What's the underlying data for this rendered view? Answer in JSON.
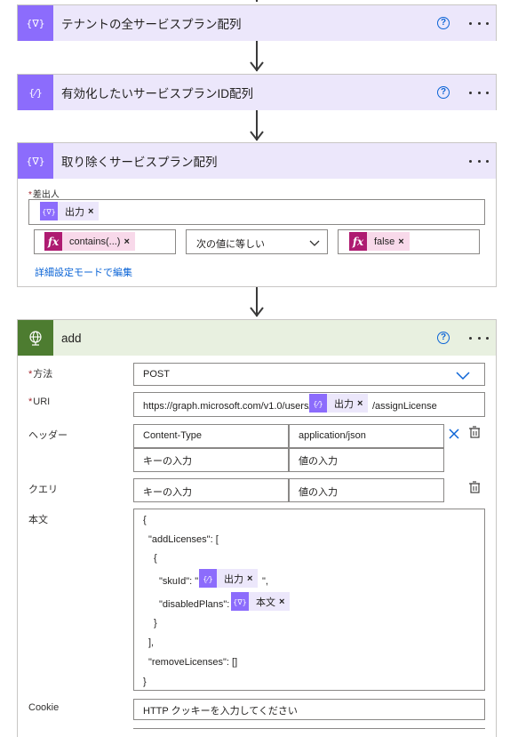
{
  "cards": {
    "c1": {
      "title": "テナントの全サービスプラン配列",
      "help": "?"
    },
    "c2": {
      "title": "有効化したいサービスプランID配列",
      "help": "?"
    },
    "c3": {
      "title": "取り除くサービスプラン配列",
      "from_label": "差出人",
      "from_token": "出力",
      "left_token": "contains(...)",
      "operator": "次の値に等しい",
      "right_token": "false",
      "advanced_link": "詳細設定モードで編集"
    },
    "c4": {
      "title": "add",
      "help": "?",
      "method_label": "方法",
      "method_value": "POST",
      "uri_label": "URI",
      "uri_prefix": "https://graph.microsoft.com/v1.0/users/",
      "uri_token": "出力",
      "uri_suffix": "/assignLicense",
      "headers_label": "ヘッダー",
      "header_key": "Content-Type",
      "header_value": "application/json",
      "key_placeholder": "キーの入力",
      "value_placeholder": "値の入力",
      "query_label": "クエリ",
      "body_label": "本文",
      "body": {
        "l1": "{",
        "l2": "\"addLicenses\": [",
        "l3": "{",
        "l4a": "\"skuId\": \"",
        "l4_token": "出力",
        "l4b": "\",",
        "l5a": "\"disabledPlans\":",
        "l5_token": "本文",
        "l6": "}",
        "l7": "],",
        "l8": "\"removeLicenses\": []",
        "l9": "}"
      },
      "cookie_label": "Cookie",
      "cookie_placeholder": "HTTP クッキーを入力してください"
    }
  },
  "required_mark": "*",
  "remove_glyph": "×",
  "colors": {
    "variable": "#8c6cfc",
    "expression": "#ae1b71",
    "http": "#4d7c30",
    "link": "#0b64d6"
  }
}
